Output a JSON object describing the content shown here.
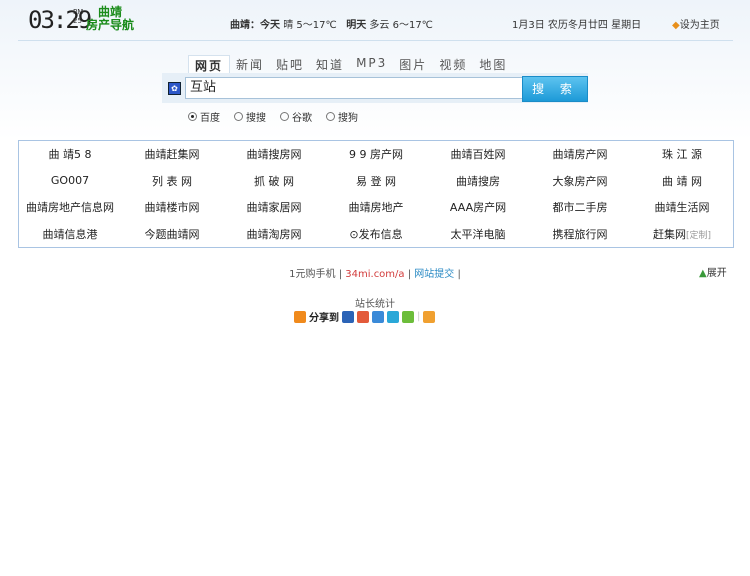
{
  "header": {
    "clock": "03:29",
    "ampm": "PM",
    "seconds": "25",
    "logo_line1": "曲靖",
    "logo_line2": "房产导航",
    "city": "曲靖：",
    "today_label": "今天",
    "today_weather": "晴 5～17℃",
    "tomorrow_label": "明天",
    "tomorrow_weather": "多云 6～17℃",
    "date": "1月3日 农历冬月廿四 星期日",
    "set_home": "设为主页"
  },
  "search": {
    "tabs": [
      "网页",
      "新闻",
      "贴吧",
      "知道",
      "MP3",
      "图片",
      "视频",
      "地图"
    ],
    "query": "互站",
    "button": "搜 索",
    "engines": [
      "百度",
      "搜搜",
      "谷歌",
      "搜狗"
    ],
    "selected_engine": "百度"
  },
  "links": [
    "曲 靖5 8",
    "曲靖赶集网",
    "曲靖搜房网",
    "9 9 房产网",
    "曲靖百姓网",
    "曲靖房产网",
    "珠 江 源",
    "GO007",
    "列 表 网",
    "抓 破 网",
    "易 登 网",
    "曲靖搜房",
    "大象房产网",
    "曲 靖 网",
    "曲靖房地产信息网",
    "曲靖楼市网",
    "曲靖家居网",
    "曲靖房地产",
    "AAA房产网",
    "都市二手房",
    "曲靖生活网",
    "曲靖信息港",
    "今题曲靖网",
    "曲靖淘房网",
    "⊙发布信息",
    "太平洋电脑",
    "携程旅行网",
    "赶集网"
  ],
  "custom_label": "[定制]",
  "footer": {
    "item1": "1元购手机",
    "item2": "34mi.com/a",
    "item3": "网站提交",
    "expand": "展开",
    "stats": "站长统计",
    "share": "分享到"
  }
}
